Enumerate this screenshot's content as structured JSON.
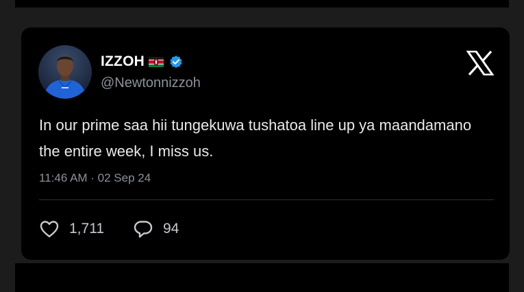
{
  "tweet": {
    "display_name": "IZZOH",
    "flag": "kenya-flag",
    "verified": true,
    "handle": "@Newtonnizzoh",
    "text": "In our prime saa hii tungekuwa tushatoa line up ya maandamano the entire week, I miss us.",
    "timestamp": "11:46 AM · 02 Sep 24",
    "brand_icon": "x-logo",
    "accent_color": "#1d9bf0"
  },
  "stats": {
    "likes": "1,711",
    "replies": "94"
  },
  "icons": {
    "like": "heart-icon",
    "reply": "comment-icon"
  }
}
